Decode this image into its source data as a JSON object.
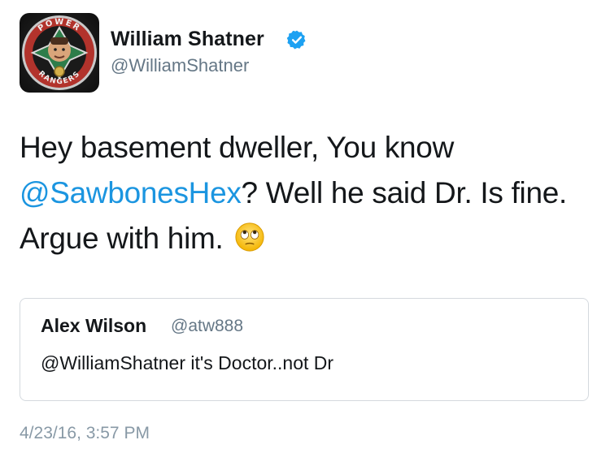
{
  "author": {
    "name": "William Shatner",
    "handle": "@WilliamShatner",
    "verified": true,
    "avatar_ring_text_top": "POWER",
    "avatar_ring_text_bottom": "RANGERS"
  },
  "tweet": {
    "line1": "Hey basement dweller, You know",
    "mention": "@SawbonesHex",
    "line2_rest": "? Well he said Dr. Is fine.",
    "line3": "Argue with him.",
    "emoji": "eye-roll-emoji-icon"
  },
  "quoted_tweet": {
    "name": "Alex Wilson",
    "handle": "@atw888",
    "text": "@WilliamShatner it's Doctor..not Dr"
  },
  "timestamp": "4/23/16, 3:57 PM",
  "colors": {
    "link": "#1b95e0",
    "verified": "#1da1f2",
    "secondary_text": "#657786",
    "border": "#d4d9de"
  }
}
